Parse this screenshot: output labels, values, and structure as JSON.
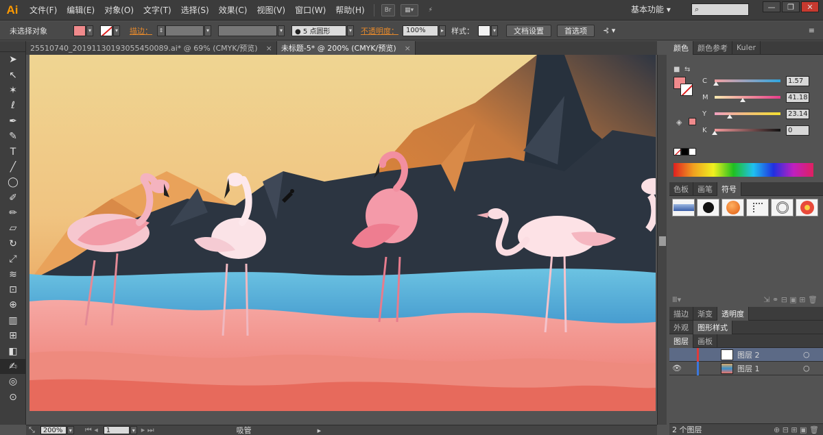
{
  "app": {
    "logo": "Ai",
    "menus": [
      "文件(F)",
      "编辑(E)",
      "对象(O)",
      "文字(T)",
      "选择(S)",
      "效果(C)",
      "视图(V)",
      "窗口(W)",
      "帮助(H)"
    ],
    "bridge_label": "Br",
    "workspace": "基本功能",
    "window_buttons": [
      "—",
      "❐",
      "✕"
    ]
  },
  "controlbar": {
    "selection_label": "未选择对象",
    "fill_color": "#f08a8c",
    "stroke_label": "描边：",
    "stroke_width": "",
    "brush_value": "",
    "brush_label": "● 5 点圆形",
    "opacity_label": "不透明度：",
    "opacity_value": "100%",
    "style_label": "样式：",
    "doc_setup_btn": "文档设置",
    "prefs_btn": "首选项"
  },
  "tabs": [
    {
      "label": "25510740_20191130193055450089.ai* @ 69% (CMYK/预览)",
      "active": false
    },
    {
      "label": "未标题-5* @ 200% (CMYK/预览)",
      "active": true
    }
  ],
  "color_panel": {
    "tabs": [
      "颜色",
      "颜色参考",
      "Kuler"
    ],
    "active_tab": "颜色",
    "fill_color": "#f08a8c",
    "channels": [
      {
        "name": "C",
        "value": "1.57",
        "pos": 0.02,
        "gradient": "linear-gradient(to right,#f5a0a2,#2ea6e0)"
      },
      {
        "name": "M",
        "value": "41.18",
        "pos": 0.41,
        "gradient": "linear-gradient(to right,#f8e9b0,#e73c8a)"
      },
      {
        "name": "Y",
        "value": "23.14",
        "pos": 0.23,
        "gradient": "linear-gradient(to right,#f0a0c0,#f4e030)"
      },
      {
        "name": "K",
        "value": "0",
        "pos": 0.0,
        "gradient": "linear-gradient(to right,#f59a9c,#111111)"
      }
    ]
  },
  "symbols_panel": {
    "tabs": [
      "色板",
      "画笔",
      "符号"
    ],
    "active_tab": "符号"
  },
  "stroke_panel": {
    "tabs": [
      "描边",
      "渐变",
      "透明度"
    ],
    "active_tab": "透明度"
  },
  "appearance_panel": {
    "tabs": [
      "外观",
      "图形样式"
    ],
    "active_tab": "图形样式"
  },
  "layers_panel": {
    "tabs": [
      "图层",
      "画板"
    ],
    "active_tab": "图层",
    "layers": [
      {
        "name": "图层 2",
        "selected": true,
        "color": "#e03a3a"
      },
      {
        "name": "图层 1",
        "selected": false,
        "color": "#3a78e0"
      }
    ],
    "count_label": "2 个图层"
  },
  "status": {
    "zoom": "200%",
    "page": "1",
    "tool_label": "吸管"
  }
}
